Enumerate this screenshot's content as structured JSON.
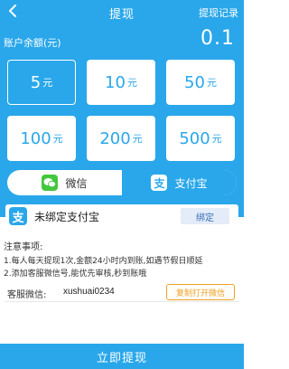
{
  "header": {
    "title": "提现",
    "record_link": "提现记录"
  },
  "balance": {
    "label": "账户余额(元)",
    "value": "0.1"
  },
  "amounts": [
    {
      "value": "5",
      "unit": "元",
      "selected": true
    },
    {
      "value": "10",
      "unit": "元",
      "selected": false
    },
    {
      "value": "50",
      "unit": "元",
      "selected": false
    },
    {
      "value": "100",
      "unit": "元",
      "selected": false
    },
    {
      "value": "200",
      "unit": "元",
      "selected": false
    },
    {
      "value": "500",
      "unit": "元",
      "selected": false
    }
  ],
  "payment": {
    "wechat_label": "微信",
    "alipay_label": "支付宝",
    "selected": "alipay"
  },
  "bind": {
    "status_text": "未绑定支付宝",
    "button_label": "绑定",
    "logo_char": "支"
  },
  "notes": {
    "title": "注意事项:",
    "items": [
      "1.每人每天提现1次,金额24小时内到账,如遇节假日顺延",
      "2.添加客服微信号,能优先审核,秒到账哦"
    ]
  },
  "service": {
    "label": "客服微信:",
    "wechat_id": "xushuai0234",
    "copy_button": "复制打开微信"
  },
  "submit_label": "立即提现",
  "colors": {
    "primary": "#29a7ea",
    "wechat_green": "#43c73c",
    "accent_orange": "#f0a12a"
  }
}
